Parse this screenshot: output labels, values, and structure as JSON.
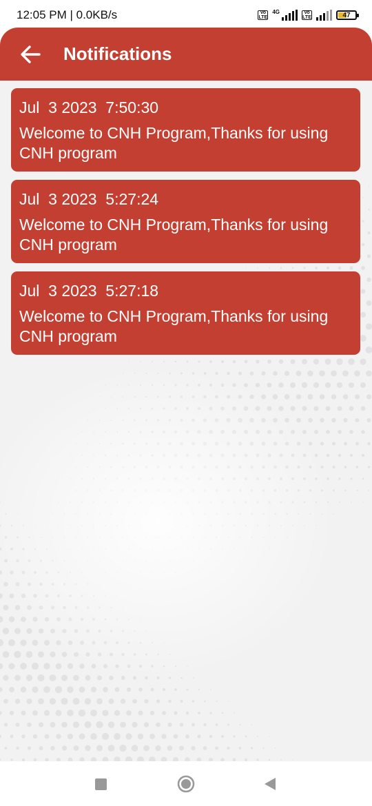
{
  "status_bar": {
    "time_speed": "12:05 PM | 0.0KB/s",
    "volte1": "Vo LTE",
    "network_type": "4G",
    "volte2": "Vo LTE",
    "battery": "47"
  },
  "app_bar": {
    "title": "Notifications",
    "back_icon": "arrow-left-icon"
  },
  "notifications": [
    {
      "date": "Jul  3 2023  7:50:30",
      "message": "Welcome to CNH Program,Thanks for using CNH program"
    },
    {
      "date": "Jul  3 2023  5:27:24",
      "message": "Welcome to CNH Program,Thanks for using CNH program"
    },
    {
      "date": "Jul  3 2023  5:27:18",
      "message": "Welcome to CNH Program,Thanks for using CNH program"
    }
  ],
  "nav_bar": {
    "recents_icon": "square-icon",
    "home_icon": "circle-icon",
    "back_icon": "triangle-back-icon"
  },
  "colors": {
    "primary": "#c23f31",
    "background": "#f3f3f3",
    "text_on_primary": "#ffffff"
  }
}
